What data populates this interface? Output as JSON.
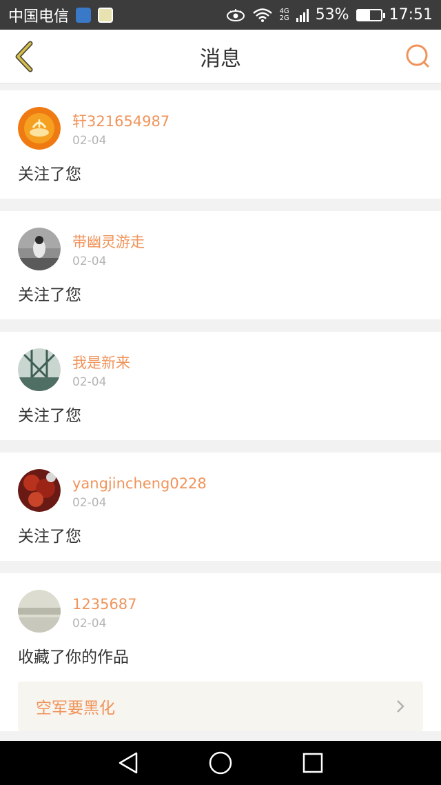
{
  "status_bar": {
    "carrier": "中国电信",
    "network_top": "4G",
    "network_bottom": "2G",
    "battery_percent": "53%",
    "battery_level": 0.53,
    "time": "17:51",
    "icons": [
      "app-icon-blue",
      "wechat-icon",
      "eye-icon",
      "wifi-icon",
      "signal-icon",
      "battery-icon"
    ]
  },
  "header": {
    "title": "消息",
    "back_icon": "back-chevron-icon",
    "search_icon": "search-icon",
    "accent_color": "#f0935a",
    "back_color": "#d9c04a"
  },
  "messages": [
    {
      "username": "轩321654987",
      "date": "02-04",
      "action": "关注了您"
    },
    {
      "username": "带幽灵游走",
      "date": "02-04",
      "action": "关注了您"
    },
    {
      "username": "我是新来",
      "date": "02-04",
      "action": "关注了您"
    },
    {
      "username": "yangjincheng0228",
      "date": "02-04",
      "action": "关注了您"
    },
    {
      "username": "1235687",
      "date": "02-04",
      "action": "收藏了你的作品",
      "work_title": "空军要黑化"
    }
  ],
  "nav_bar": {
    "icons": [
      "back-triangle-icon",
      "home-circle-icon",
      "recents-square-icon"
    ]
  }
}
